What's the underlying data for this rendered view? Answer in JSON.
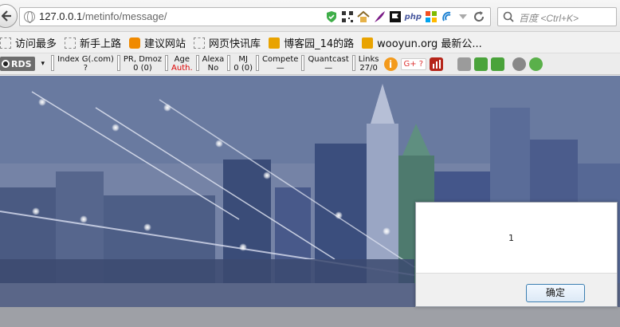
{
  "nav": {
    "url_host": "127.0.0.1",
    "url_path": "/metinfo/message/",
    "search_placeholder": "百度 <Ctrl+K>",
    "php_label": "php"
  },
  "bookmarks": [
    {
      "label": "访问最多",
      "icon": "dashed-folder-icon"
    },
    {
      "label": "新手上路",
      "icon": "dashed-folder-icon"
    },
    {
      "label": "建议网站",
      "icon": "bulb-icon"
    },
    {
      "label": "网页快讯库",
      "icon": "dashed-folder-icon"
    },
    {
      "label": "博客园_14的路",
      "icon": "rss-icon"
    },
    {
      "label": "wooyun.org 最新公...",
      "icon": "rss-icon"
    }
  ],
  "seo": {
    "rds_label": "RDS",
    "dropdown_glyph": "▾",
    "metrics": [
      {
        "label": "Index G(.com)",
        "value": "?"
      },
      {
        "label": "PR, Dmoz",
        "value": "0 (0)"
      },
      {
        "label": "Age",
        "value": "Auth.",
        "red": true
      },
      {
        "label": "Alexa",
        "value": "No"
      },
      {
        "label": "MJ",
        "value": "0 (0)"
      },
      {
        "label": "Compete",
        "value": "—"
      },
      {
        "label": "Quantcast",
        "value": "—"
      },
      {
        "label": "Links",
        "value": "27/0"
      }
    ],
    "gplus_label": "G+ ?"
  },
  "dialog": {
    "message": "1",
    "ok_label": "确定"
  },
  "colors": {
    "dialog_border": "#9aa0aa",
    "ok_border": "#3c7fb1",
    "accent_red": "#dd0000"
  }
}
